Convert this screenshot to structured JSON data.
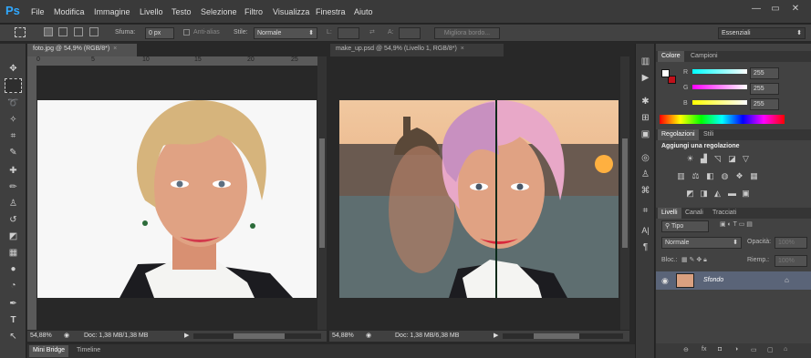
{
  "app": {
    "logo": "Ps"
  },
  "menu": [
    "File",
    "Modifica",
    "Immagine",
    "Livello",
    "Testo",
    "Selezione",
    "Filtro",
    "Visualizza",
    "Finestra",
    "Aiuto"
  ],
  "window_controls": [
    "—",
    "▭",
    "✕"
  ],
  "options": {
    "sfuma_label": "Sfuma:",
    "sfuma_value": "0 px",
    "antialias_label": "Anti-alias",
    "stile_label": "Stile:",
    "stile_value": "Normale",
    "l_label": "L:",
    "a_label": "A:",
    "migliora_label": "Migliora bordo...",
    "workspace_value": "Essenziali"
  },
  "docA": {
    "tab_title": "foto.jpg @ 54,9% (RGB/8*)",
    "ruler": [
      "0",
      "5",
      "10",
      "15",
      "20",
      "25"
    ],
    "zoom": "54,88%",
    "doc_info": "Doc: 1,38 MB/1,38 MB"
  },
  "docB": {
    "tab_title": "make_up.psd @ 54,9% (Livello 1, RGB/8*)",
    "zoom": "54,88%",
    "doc_info": "Doc: 1,38 MB/6,38 MB"
  },
  "bottom_tabs": [
    "Mini Bridge",
    "Timeline"
  ],
  "colore": {
    "tabs": [
      "Colore",
      "Campioni"
    ],
    "channels": [
      {
        "label": "R",
        "value": "255"
      },
      {
        "label": "G",
        "value": "255"
      },
      {
        "label": "B",
        "value": "255"
      }
    ],
    "colors": {
      "foreground": "#ffffff",
      "background": "#c0101a"
    }
  },
  "regolazioni": {
    "tabs": [
      "Regolazioni",
      "Stili"
    ],
    "title": "Aggiungi una regolazione"
  },
  "livelli": {
    "tabs": [
      "Livelli",
      "Canali",
      "Tracciati"
    ],
    "filter_value": "Tipo",
    "blend_value": "Normale",
    "opacity_label": "Opacità:",
    "opacity_value": "100%",
    "lock_label": "Bloc.:",
    "fill_label": "Riemp.:",
    "fill_value": "100%",
    "layers": [
      {
        "name": "Sfondo"
      }
    ]
  }
}
